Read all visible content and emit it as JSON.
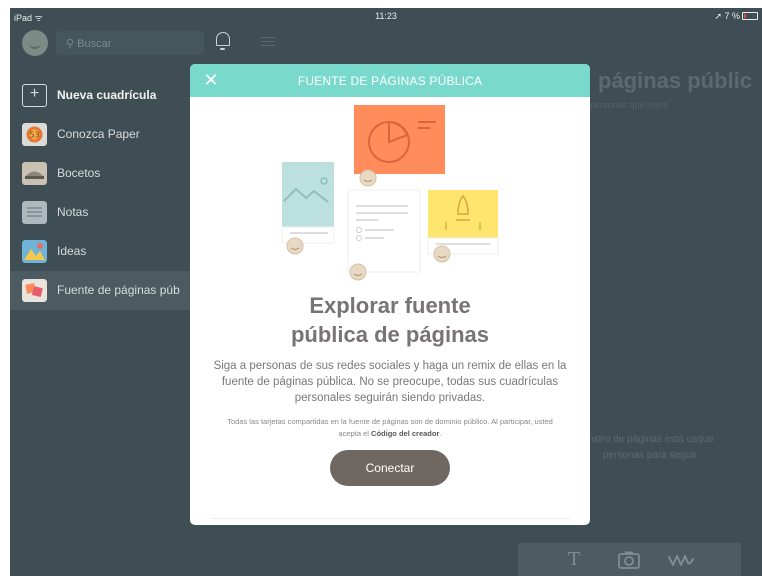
{
  "status_bar": {
    "device": "iPad",
    "time": "11:23",
    "battery": "7 %"
  },
  "sidebar": {
    "search_placeholder": "Buscar",
    "items": [
      {
        "label": "Nueva cuadrícula",
        "icon": "plus-icon"
      },
      {
        "label": "Conozca Paper",
        "icon": "conozca-paper-thumbnail"
      },
      {
        "label": "Bocetos",
        "icon": "bocetos-thumbnail"
      },
      {
        "label": "Notas",
        "icon": "notas-thumbnail"
      },
      {
        "label": "Ideas",
        "icon": "ideas-thumbnail"
      },
      {
        "label": "Fuente de páginas púb",
        "icon": "fuente-thumbnail"
      }
    ]
  },
  "background": {
    "title": "páginas públic",
    "subtitle": "personas que sigue",
    "empty_text": "nstro de páginas está usque personas para seguir."
  },
  "toolbar": {
    "text_tool": "T",
    "camera_tool": "camera-icon",
    "draw_tool": "scribble-icon"
  },
  "modal": {
    "header_title": "FUENTE DE PÁGINAS PÚBLICA",
    "headline_line1": "Explorar fuente",
    "headline_line2": "pública de páginas",
    "body": "Siga a personas de sus redes sociales y haga un remix de ellas en la fuente de páginas pública. No se preocupe, todas sus cuadrículas personales seguirán siendo privadas.",
    "fine_print_prefix": "Todas las tarjetas compartidas en la fuente de páginas son de dominio público. Al participar, usted acepta el",
    "fine_print_link": "Código del creador",
    "fine_print_suffix": ".",
    "connect_label": "Conectar"
  },
  "colors": {
    "header": "#7ad9cd",
    "background_app": "#3f4e54",
    "button": "#6f6762",
    "orange_card": "#ff8c5a",
    "yellow_card": "#fde56f",
    "teal_card": "#bce0dd"
  }
}
